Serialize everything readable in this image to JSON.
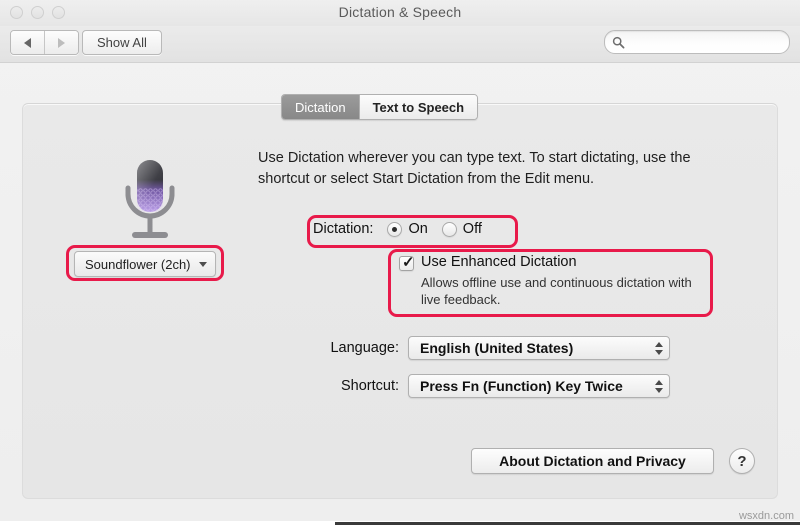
{
  "window": {
    "title": "Dictation & Speech",
    "traffic_lights": [
      "close",
      "minimize",
      "zoom"
    ]
  },
  "toolbar": {
    "back_label": "◀",
    "forward_label": "▶",
    "show_all_label": "Show All",
    "search": {
      "value": "",
      "placeholder": "",
      "icon": "search-icon"
    }
  },
  "tabs": [
    {
      "label": "Dictation",
      "selected": true
    },
    {
      "label": "Text to Speech",
      "selected": false
    }
  ],
  "main": {
    "description": "Use Dictation wherever you can type text. To start dictating, use the shortcut or select Start Dictation from the Edit menu.",
    "mic_icon": "microphone-icon",
    "source_popup": {
      "value": "Soundflower (2ch)",
      "caret": "chevron-down-icon"
    },
    "dictation": {
      "label": "Dictation:",
      "options": [
        {
          "label": "On",
          "selected": true
        },
        {
          "label": "Off",
          "selected": false
        }
      ]
    },
    "enhanced": {
      "label": "Use Enhanced Dictation",
      "checked": true,
      "check_glyph": "✓",
      "sub_text": "Allows offline use and continuous dictation with live feedback."
    },
    "language": {
      "label": "Language:",
      "value": "English (United States)"
    },
    "shortcut": {
      "label": "Shortcut:",
      "value": "Press Fn (Function) Key Twice"
    },
    "about_button": "About Dictation and Privacy",
    "help_button": "?"
  },
  "annotations": {
    "color": "#e81a4a",
    "boxes": [
      "source-popup",
      "dictation-row",
      "enhanced-dictation"
    ]
  },
  "watermark": "wsxdn.com"
}
